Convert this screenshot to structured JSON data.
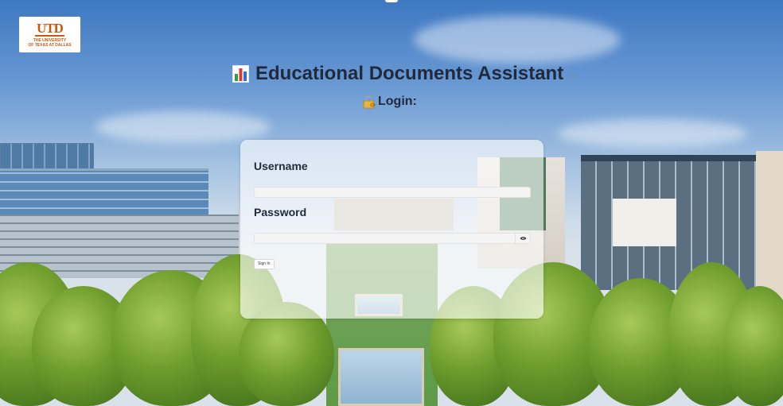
{
  "logo": {
    "mark": "UTD",
    "text_line1": "THE UNIVERSITY",
    "text_line2": "OF TEXAS AT DALLAS"
  },
  "header": {
    "title": "Educational Documents Assistant",
    "title_icon": "bar-chart-icon"
  },
  "login": {
    "heading": "Login:",
    "heading_icon": "lock-with-key-icon",
    "username_label": "Username",
    "username_value": "",
    "password_label": "Password",
    "password_value": "",
    "show_password_icon": "eye-icon",
    "submit_label": "Sign In"
  },
  "colors": {
    "title_text": "#1f2a3d",
    "logo_orange": "#c75b12",
    "card_background": "rgba(255,255,255,0.62)"
  }
}
